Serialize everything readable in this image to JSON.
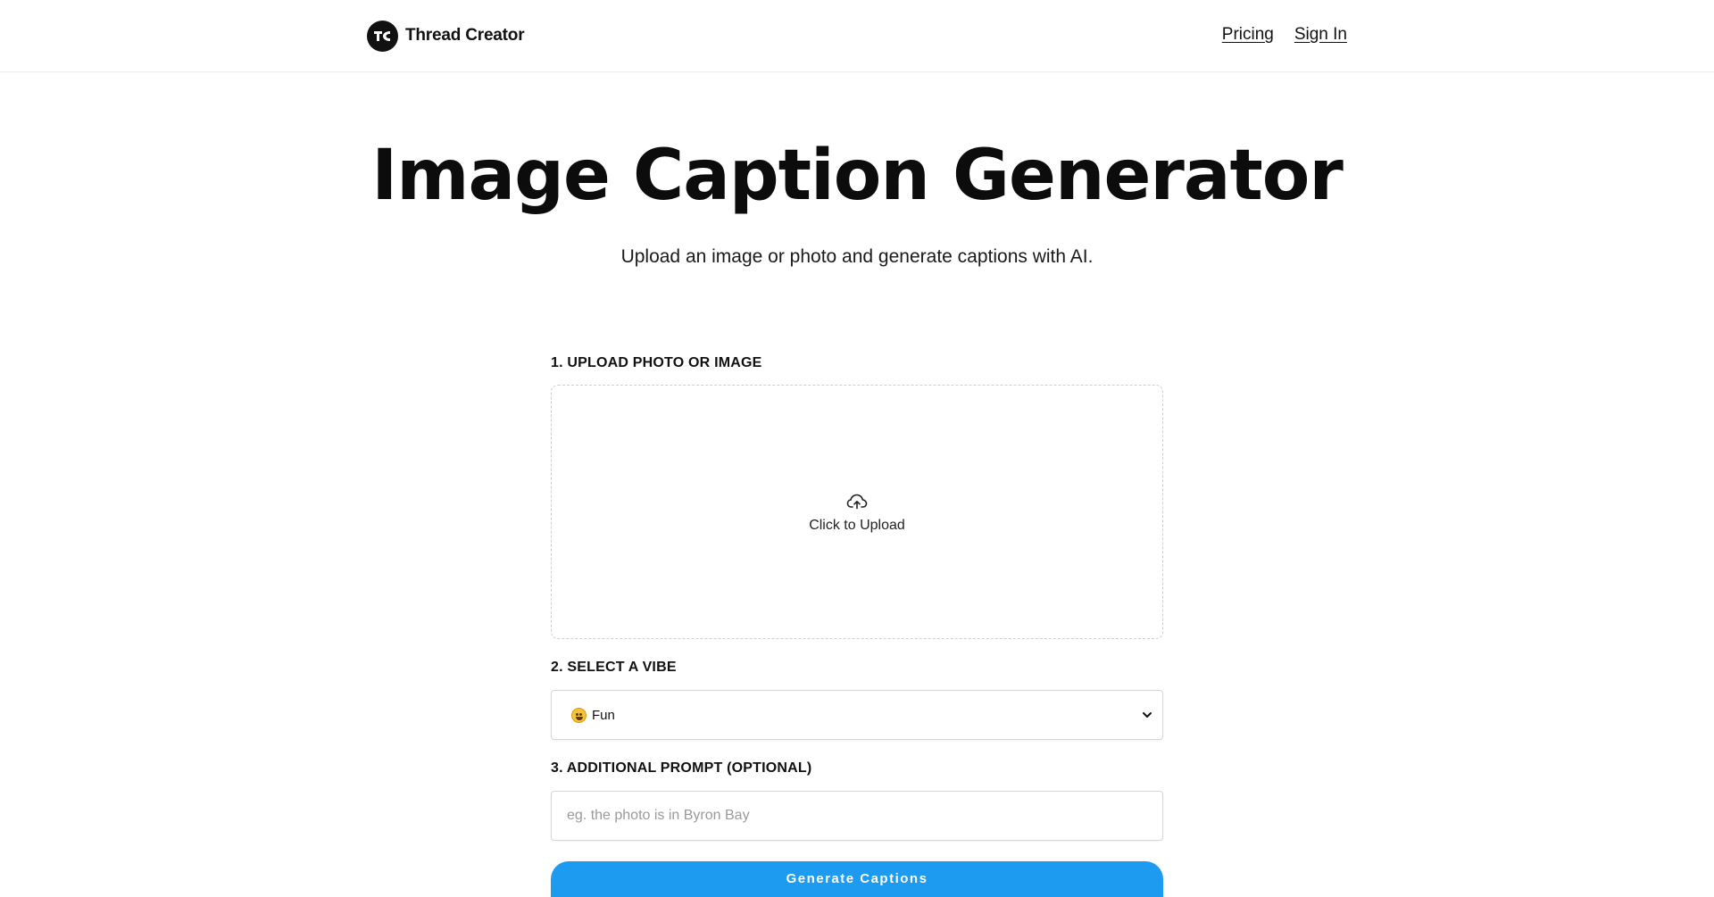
{
  "header": {
    "brand_name": "Thread Creator",
    "nav": {
      "pricing_label": "Pricing",
      "signin_label": "Sign In"
    }
  },
  "hero": {
    "title": "Image Caption Generator",
    "subtitle": "Upload an image or photo and generate captions with AI."
  },
  "form": {
    "step1_label": "1. UPLOAD PHOTO OR IMAGE",
    "upload_icon": "cloud-upload-icon",
    "upload_text": "Click to Upload",
    "step2_label": "2. SELECT A VIBE",
    "vibe_emoji": "grinning-face-icon",
    "vibe_selected": "Fun",
    "step3_label": "3. ADDITIONAL PROMPT (OPTIONAL)",
    "prompt_value": "",
    "prompt_placeholder": "eg. the photo is in Byron Bay",
    "generate_label": "Generate Captions"
  },
  "colors": {
    "accent": "#1d9bf0",
    "text": "#111111",
    "border": "#d6d6d6"
  }
}
